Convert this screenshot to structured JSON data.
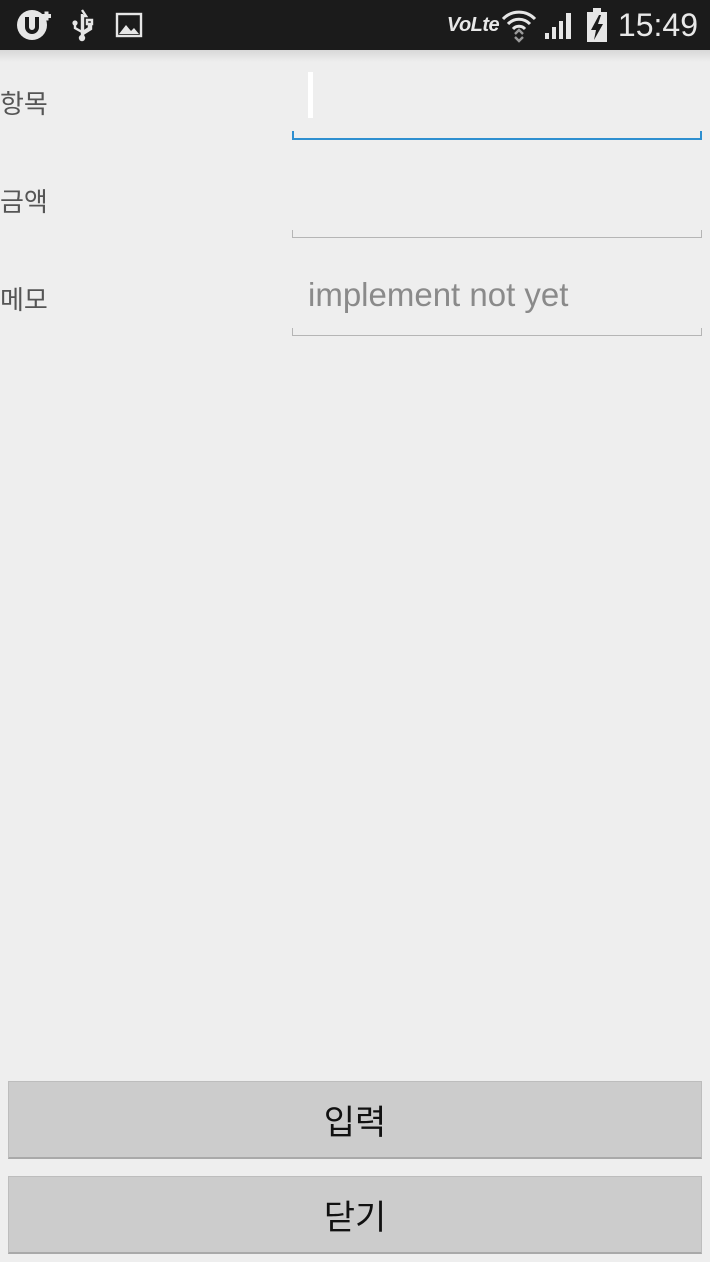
{
  "status_bar": {
    "time": "15:49",
    "volte_label": "Vo",
    "lte_label": "Lte",
    "icons": [
      "u-plus-icon",
      "usb-icon",
      "image-icon",
      "wifi-icon",
      "signal-icon",
      "battery-charging-icon"
    ]
  },
  "form": {
    "item_label": "항목",
    "item_value": "",
    "amount_label": "금액",
    "amount_value": "",
    "memo_label": "메모",
    "memo_value": "implement not yet"
  },
  "buttons": {
    "submit_label": "입력",
    "close_label": "닫기"
  },
  "colors": {
    "accent": "#2e8fd0",
    "status_bar": "#1b1b1b",
    "background": "#eeeeee",
    "button": "#cccccc"
  }
}
